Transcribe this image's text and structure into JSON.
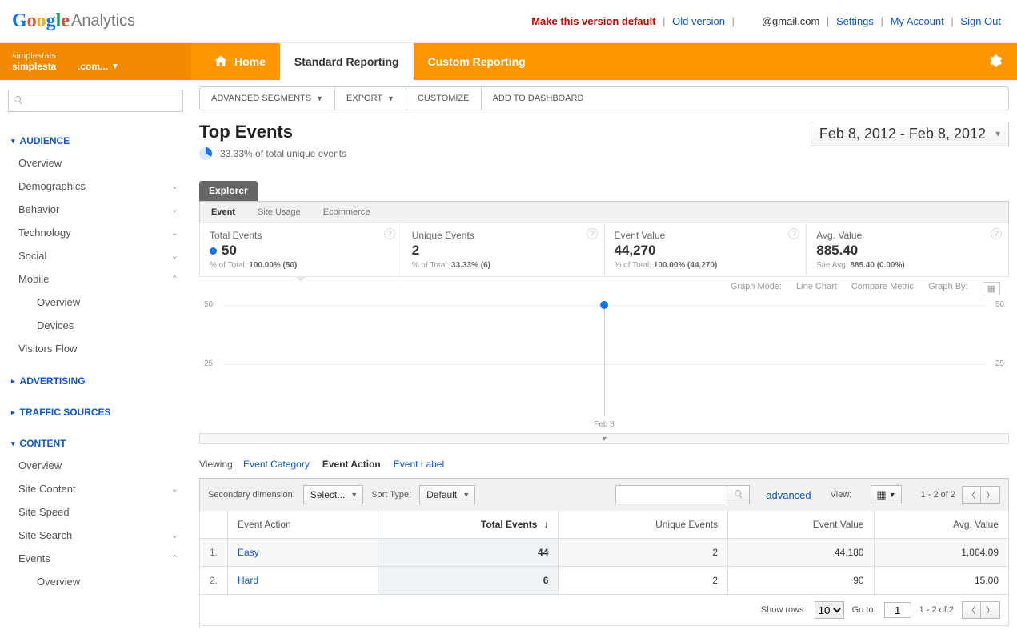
{
  "header": {
    "make_default": "Make this version default",
    "old_version": "Old version",
    "email_suffix": "@gmail.com",
    "settings": "Settings",
    "my_account": "My Account",
    "sign_out": "Sign Out",
    "logo_analytics": "Analytics"
  },
  "account": {
    "label": "simplestats",
    "label2": "simplesta",
    "domain": ".com..."
  },
  "nav": {
    "home": "Home",
    "standard": "Standard Reporting",
    "custom": "Custom Reporting"
  },
  "toolbar": {
    "advanced_segments": "ADVANCED SEGMENTS",
    "export": "EXPORT",
    "customize": "CUSTOMIZE",
    "add_to_dashboard": "ADD TO DASHBOARD"
  },
  "page": {
    "title": "Top Events",
    "subtitle": "33.33% of total unique events",
    "date_range": "Feb 8, 2012 - Feb 8, 2012"
  },
  "sidebar": {
    "audience": "AUDIENCE",
    "items_audience": [
      "Overview",
      "Demographics",
      "Behavior",
      "Technology",
      "Social",
      "Mobile"
    ],
    "mobile_sub": [
      "Overview",
      "Devices"
    ],
    "visitors_flow": "Visitors Flow",
    "advertising": "ADVERTISING",
    "traffic": "TRAFFIC SOURCES",
    "content": "CONTENT",
    "items_content": [
      "Overview",
      "Site Content",
      "Site Speed",
      "Site Search",
      "Events"
    ],
    "events_sub": [
      "Overview"
    ]
  },
  "explorer": {
    "tab": "Explorer",
    "subtabs": [
      "Event",
      "Site Usage",
      "Ecommerce"
    ]
  },
  "metrics": [
    {
      "label": "Total Events",
      "value": "50",
      "foot_pre": "% of Total: ",
      "foot_b": "100.00% (50)",
      "dot": true
    },
    {
      "label": "Unique Events",
      "value": "2",
      "foot_pre": "% of Total: ",
      "foot_b": "33.33% (6)",
      "dot": false
    },
    {
      "label": "Event Value",
      "value": "44,270",
      "foot_pre": "% of Total: ",
      "foot_b": "100.00% (44,270)",
      "dot": false
    },
    {
      "label": "Avg. Value",
      "value": "885.40",
      "foot_pre": "Site Avg: ",
      "foot_b": "885.40 (0.00%)",
      "dot": false
    }
  ],
  "chart_data": {
    "type": "line",
    "x": [
      "Feb 8"
    ],
    "series": [
      {
        "name": "Total Events",
        "values": [
          50
        ]
      }
    ],
    "ylim": [
      0,
      50
    ],
    "yticks": [
      25,
      50
    ],
    "xlabel": "Feb 8",
    "controls": {
      "graph_mode": "Graph Mode:",
      "line_chart": "Line Chart",
      "compare_metric": "Compare Metric",
      "graph_by": "Graph By:"
    }
  },
  "viewing": {
    "label": "Viewing:",
    "tabs": [
      "Event Category",
      "Event Action",
      "Event Label"
    ],
    "active_index": 1
  },
  "controls": {
    "secondary_dim": "Secondary dimension:",
    "select": "Select...",
    "sort_type": "Sort Type:",
    "default": "Default",
    "advanced": "advanced",
    "view": "View:",
    "page_text": "1 - 2 of 2"
  },
  "table": {
    "cols": [
      "Event Action",
      "Total Events",
      "Unique Events",
      "Event Value",
      "Avg. Value"
    ],
    "rows": [
      {
        "idx": "1.",
        "label": "Easy",
        "total": "44",
        "unique": "2",
        "value": "44,180",
        "avg": "1,004.09"
      },
      {
        "idx": "2.",
        "label": "Hard",
        "total": "6",
        "unique": "2",
        "value": "90",
        "avg": "15.00"
      }
    ]
  },
  "footer": {
    "show_rows": "Show rows:",
    "rows_value": "10",
    "go_to": "Go to:",
    "go_value": "1",
    "page_text": "1 - 2 of 2"
  }
}
